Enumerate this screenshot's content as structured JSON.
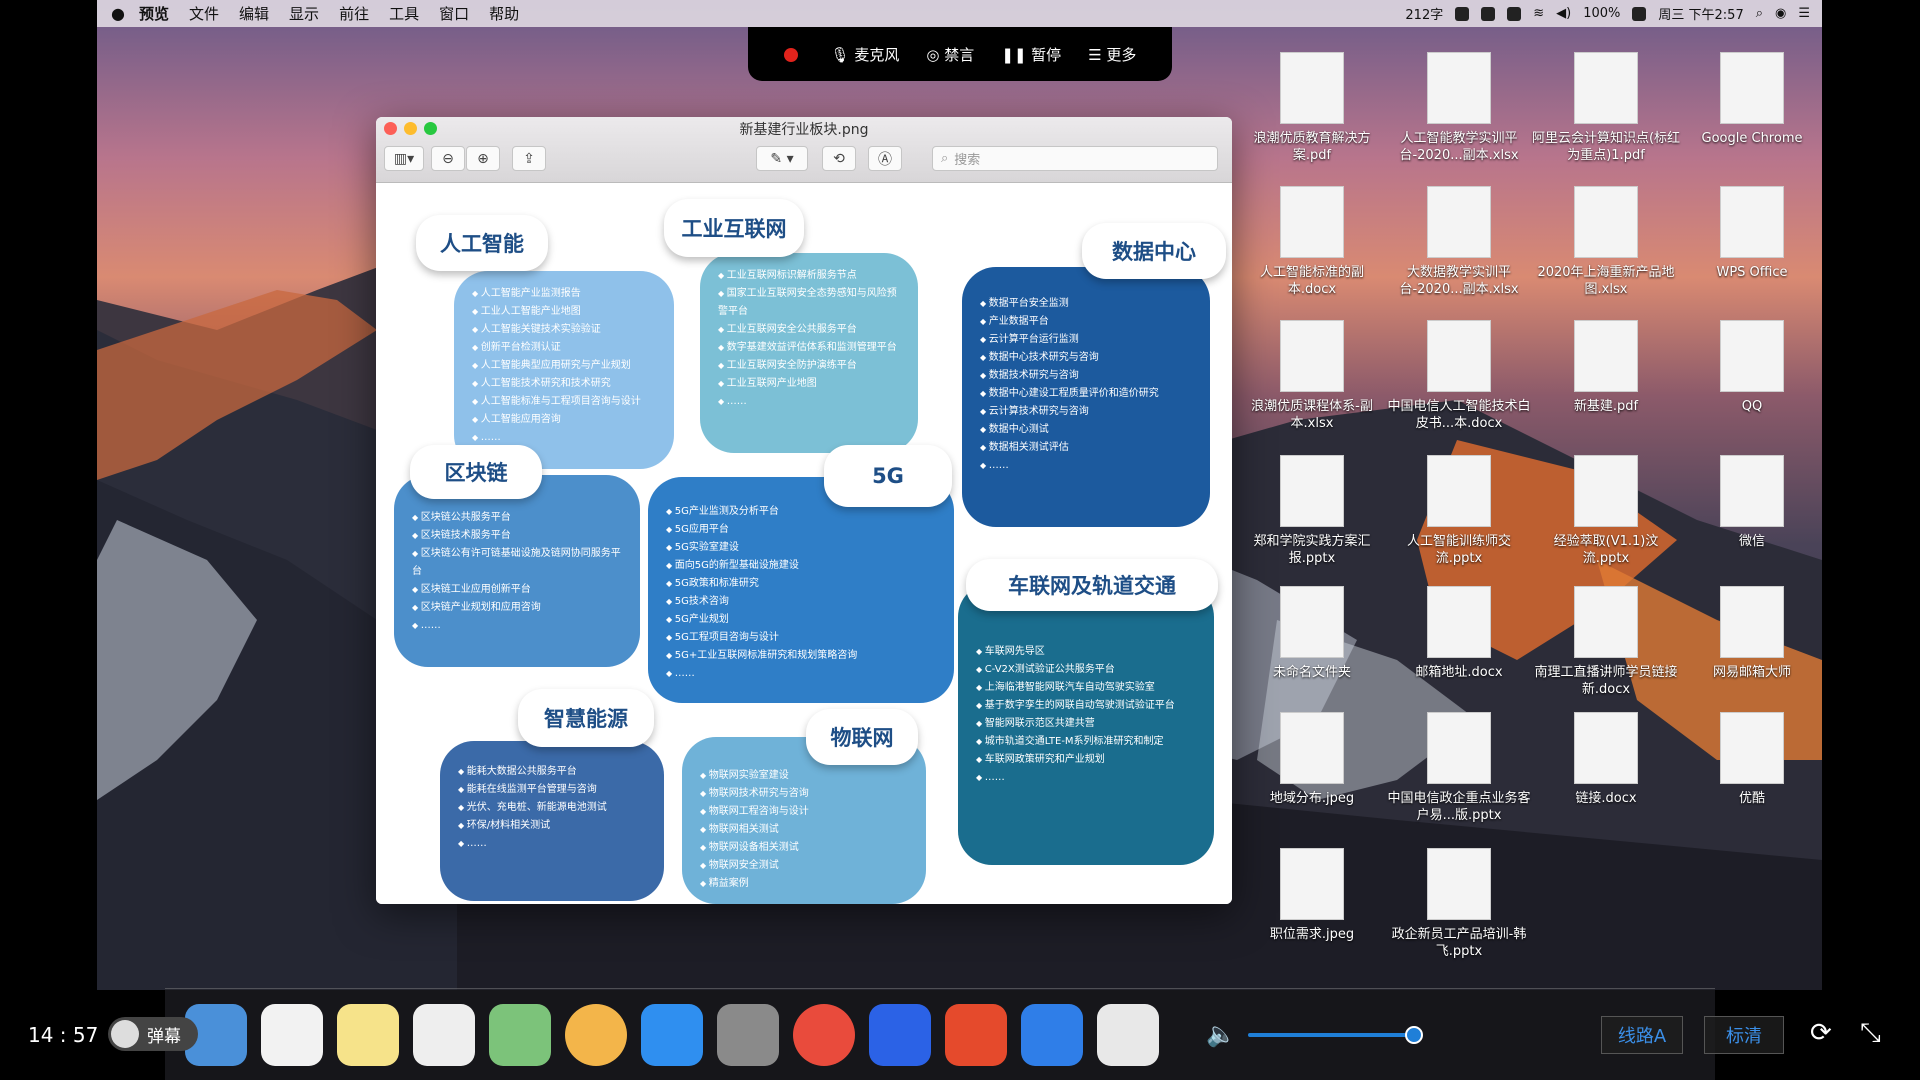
{
  "menubar": {
    "items": [
      "预览",
      "文件",
      "编辑",
      "显示",
      "前往",
      "工具",
      "窗口",
      "帮助"
    ],
    "status": [
      "212字",
      "100%",
      "周三 下午2:57"
    ]
  },
  "recording_bar": {
    "mic": "麦克风",
    "audio": "禁言",
    "pause": "暂停",
    "more": "更多"
  },
  "window": {
    "title": "新基建行业板块.png",
    "search_placeholder": "搜索"
  },
  "infographic": {
    "ai": {
      "title": "人工智能",
      "items": [
        "人工智能产业监测报告",
        "工业人工智能产业地图",
        "人工智能关键技术实验验证",
        "创新平台检测认证",
        "人工智能典型应用研究与产业规划",
        "人工智能技术研究和技术研究",
        "人工智能标准与工程项目咨询与设计",
        "人工智能应用咨询",
        "……"
      ]
    },
    "iiot": {
      "title": "工业互联网",
      "items": [
        "工业互联网标识解析服务节点",
        "国家工业互联网安全态势感知与风险预警平台",
        "工业互联网安全公共服务平台",
        "数字基建效益评估体系和监测管理平台",
        "工业互联网安全防护演练平台",
        "工业互联网产业地图",
        "……"
      ]
    },
    "dc": {
      "title": "数据中心",
      "items": [
        "数据平台安全监测",
        "产业数据平台",
        "云计算平台运行监测",
        "数据中心技术研究与咨询",
        "数据技术研究与咨询",
        "数据中心建设工程质量评价和造价研究",
        "云计算技术研究与咨询",
        "数据中心测试",
        "数据相关测试评估",
        "……"
      ]
    },
    "bc": {
      "title": "区块链",
      "items": [
        "区块链公共服务平台",
        "区块链技术服务平台",
        "区块链公有许可链基础设施及链网协同服务平台",
        "区块链工业应用创新平台",
        "区块链产业规划和应用咨询",
        "……"
      ]
    },
    "g5": {
      "title": "5G",
      "items": [
        "5G产业监测及分析平台",
        "5G应用平台",
        "5G实验室建设",
        "面向5G的新型基础设施建设",
        "5G政策和标准研究",
        "5G技术咨询",
        "5G产业规划",
        "5G工程项目咨询与设计",
        "5G+工业互联网标准研究和规划策略咨询",
        "……"
      ]
    },
    "v2x": {
      "title": "车联网及轨道交通",
      "items": [
        "车联网先导区",
        "C-V2X测试验证公共服务平台",
        "上海临港智能网联汽车自动驾驶实验室",
        "基于数字孪生的网联自动驾驶测试验证平台",
        "智能网联示范区共建共营",
        "城市轨道交通LTE-M系列标准研究和制定",
        "车联网政策研究和产业规划",
        "……"
      ]
    },
    "energy": {
      "title": "智慧能源",
      "items": [
        "能耗大数据公共服务平台",
        "能耗在线监测平台管理与咨询",
        "光伏、充电桩、新能源电池测试",
        "环保/材料相关测试",
        "……"
      ]
    },
    "iot": {
      "title": "物联网",
      "items": [
        "物联网实验室建设",
        "物联网技术研究与咨询",
        "物联网工程咨询与设计",
        "物联网相关测试",
        "物联网设备相关测试",
        "物联网安全测试",
        "精益案例"
      ]
    }
  },
  "desktop": {
    "icons": [
      "浪潮优质教育解决方案.pdf",
      "人工智能教学实训平台-2020...副本.xlsx",
      "阿里云会计算知识点(标红为重点)1.pdf",
      "Google Chrome",
      "人工智能标准的副本.docx",
      "大数据教学实训平台-2020...副本.xlsx",
      "2020年上海重新产品地图.xlsx",
      "WPS Office",
      "浪潮优质课程体系-副本.xlsx",
      "中国电信人工智能技术白皮书...本.docx",
      "新基建.pdf",
      "QQ",
      "郑和学院实践方案汇报.pptx",
      "人工智能训练师交流.pptx",
      "经验萃取(V1.1)汶流.pptx",
      "微信",
      "未命名文件夹",
      "邮箱地址.docx",
      "南理工直播讲师学员链接新.docx",
      "网易邮箱大师",
      "地域分布.jpeg",
      "中国电信政企重点业务客户易...版.pptx",
      "链接.docx",
      "优酷",
      "职位需求.jpeg",
      "政企新员工产品培训-韩飞.pptx"
    ]
  },
  "player": {
    "time": "14 : 57",
    "danmu": "弹幕",
    "line": "线路A",
    "quality": "标清"
  },
  "colors": {
    "blue_light": "#8fc1ea",
    "blue_mid": "#2f7ec7",
    "blue_dark": "#1c5a9e",
    "teal": "#1a6d8e",
    "slate": "#3b6aa8"
  }
}
